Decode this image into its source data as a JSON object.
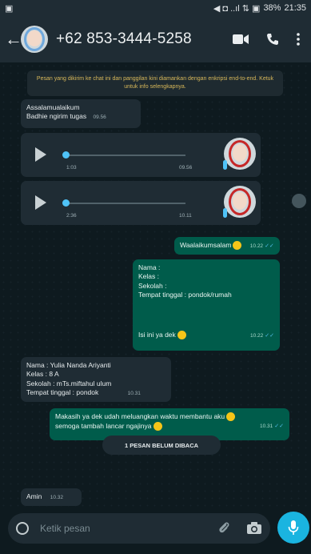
{
  "status_bar": {
    "indicators": "◀ ◘ ..ıl ⇅ ▣",
    "battery": "38%",
    "clock": "21:35"
  },
  "header": {
    "back_icon": "arrow-left-icon",
    "contact_name": "+62 853-3444-5258",
    "actions": [
      "video-call-icon",
      "phone-icon",
      "more-vert-icon"
    ]
  },
  "system_note": "Pesan yang dikirim ke chat ini dan panggilan kini diamankan dengan enkripsi end-to-end. Ketuk untuk info selengkapnya.",
  "messages": {
    "m1_line1": "Assalamualaikum",
    "m1_line2": "Badhie ngirim tugas",
    "m1_time": "09.56",
    "voice1_duration": "1:03",
    "voice1_time": "09.56",
    "voice2_duration": "2:36",
    "voice2_time": "10.11",
    "m2_text": "Waalaikumsalam",
    "m2_time": "10.22",
    "m3_l1": "Nama :",
    "m3_l2": "Kelas :",
    "m3_l3": "Sekolah :",
    "m3_l4": "Tempat tinggal : pondok/rumah",
    "m3_l5": "Isi ini ya dek",
    "m3_time": "10.22",
    "m4_l1": "Nama : Yulia Nanda Ariyanti",
    "m4_l2": "Kelas : 8 A",
    "m4_l3": "Sekolah : mTs.miftahul ulum",
    "m4_l4": "Tempat tinggal : pondok",
    "m4_time": "10.31",
    "m5_l1": "Makasih ya dek udah meluangkan waktu membantu aku",
    "m5_l2": "semoga tambah lancar ngajinya",
    "m5_time": "10.31",
    "unread_label": "1 PESAN BELUM DIBACA",
    "m6_text": "Amin",
    "m6_time": "10.32"
  },
  "composer": {
    "placeholder": "Ketik pesan",
    "icons": [
      "emoji-icon",
      "attach-icon",
      "camera-icon",
      "mic-icon"
    ]
  },
  "colors": {
    "header": "#1f2c34",
    "outgoing": "#005c4b",
    "incoming": "#1f2c34",
    "accent": "#1ab4e0"
  }
}
